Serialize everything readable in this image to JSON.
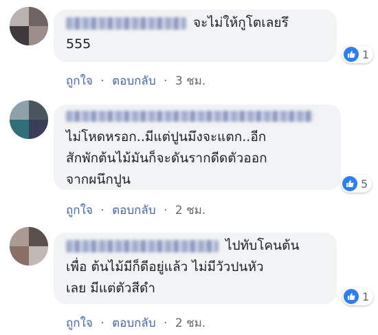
{
  "comments": [
    {
      "lines": [
        "จะไม่ให้กูโตเลยรึ",
        "555"
      ],
      "reactions": {
        "icon": "like-icon",
        "count": "1"
      },
      "actions": {
        "like": "ถูกใจ",
        "reply": "ตอบกลับ",
        "time": "3 ชม.",
        "sep": "·"
      }
    },
    {
      "lines": [
        "ไม่โหดหรอก..มีแต่ปูนมึงจะแตก..อีก",
        "สักพักต้นไม้มันก็จะดันรากดีดตัวออก",
        "จากผนึกปูน"
      ],
      "reactions": {
        "icon": "like-icon",
        "count": "5"
      },
      "actions": {
        "like": "ถูกใจ",
        "reply": "ตอบกลับ",
        "time": "2 ชม.",
        "sep": "·"
      }
    },
    {
      "lines": [
        "ไปทับโคนต้น",
        "เพื่อ ต้นไม้มีก็ดีอยู่แล้ว ไม่มีวัวปนหัว",
        "เลย มีแต่ตัวสีดำ"
      ],
      "reactions": {
        "icon": "like-icon",
        "count": "1"
      },
      "actions": {
        "like": "ถูกใจ",
        "reply": "ตอบกลับ",
        "time": "2 ชม.",
        "sep": "·"
      }
    }
  ],
  "colors": {
    "link": "#4267b2",
    "bubble": "#f2f3f5",
    "like": "#2d7ff9",
    "meta": "#606770"
  }
}
